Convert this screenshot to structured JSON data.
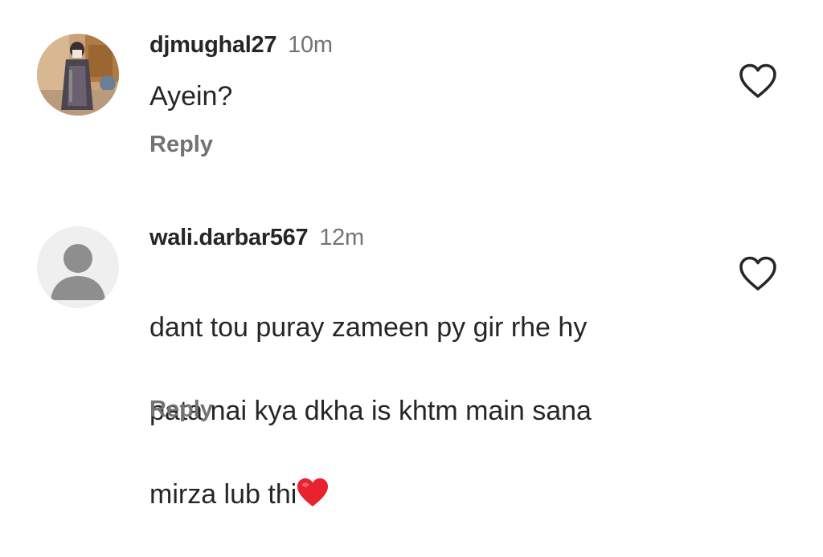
{
  "comments": [
    {
      "username": "djmughal27",
      "time": "10m",
      "text": "Ayein?",
      "reply_label": "Reply",
      "avatar_icon": "profile-photo",
      "like_icon": "heart-outline-icon"
    },
    {
      "username": "wali.darbar567",
      "time": "12m",
      "text_line1": "dant tou puray zameen py gir rhe hy",
      "text_line2": "pata nai kya dkha is khtm main sana",
      "text_line3": "mirza lub thi",
      "emoji": "red-heart",
      "reply_label": "Reply",
      "avatar_icon": "default-avatar-icon",
      "like_icon": "heart-outline-icon"
    }
  ],
  "colors": {
    "primary_text": "#262626",
    "secondary_text": "#737373",
    "emoji_heart": "#e8232f"
  }
}
